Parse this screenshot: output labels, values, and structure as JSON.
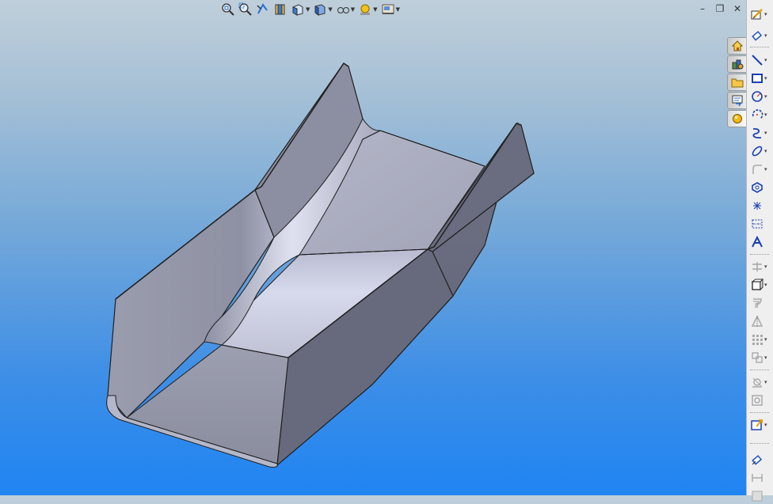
{
  "colors": {
    "background_top": "#bfcfda",
    "background_bottom": "#1f84f2",
    "part_face_light": "#c6c8dc",
    "part_face_mid": "#a3a6b6",
    "part_face_dark": "#6a6d80",
    "part_edge": "#202020"
  },
  "headsup_toolbar": {
    "items": [
      {
        "icon": "zoom-to-fit-icon"
      },
      {
        "icon": "zoom-to-area-icon"
      },
      {
        "icon": "previous-view-icon"
      },
      {
        "icon": "section-view-icon"
      },
      {
        "icon": "view-orientation-icon",
        "dropdown": true
      },
      {
        "icon": "display-style-icon",
        "dropdown": true
      },
      {
        "icon": "hide-show-items-icon",
        "dropdown": true
      },
      {
        "icon": "edit-appearance-icon",
        "dropdown": true
      },
      {
        "icon": "apply-scene-icon",
        "dropdown": true
      }
    ]
  },
  "window_controls": {
    "minimize": "–",
    "restore": "❐",
    "close": "✕"
  },
  "task_pane": {
    "tabs": [
      {
        "icon": "home-icon"
      },
      {
        "icon": "design-library-icon"
      },
      {
        "icon": "file-explorer-icon"
      },
      {
        "icon": "view-palette-icon"
      },
      {
        "icon": "appearances-icon"
      }
    ]
  },
  "command_toolbar": {
    "sketch_tools": [
      {
        "icon": "sketch-icon"
      },
      {
        "icon": "smart-dimension-icon",
        "dropdown": true
      },
      {
        "icon": "line-icon",
        "dropdown": true
      },
      {
        "icon": "rectangle-icon",
        "dropdown": true
      },
      {
        "icon": "circle-icon",
        "dropdown": true
      },
      {
        "icon": "arc-icon",
        "dropdown": true
      },
      {
        "icon": "spline-icon",
        "dropdown": true
      },
      {
        "icon": "ellipse-icon",
        "dropdown": true
      },
      {
        "icon": "fillet-icon",
        "dropdown": true
      },
      {
        "icon": "polygon-icon"
      },
      {
        "icon": "point-icon"
      },
      {
        "icon": "centerline-icon"
      },
      {
        "icon": "text-icon"
      }
    ],
    "feature_tools": [
      {
        "icon": "trim-entities-icon",
        "dropdown": true
      },
      {
        "icon": "convert-entities-icon",
        "dropdown": true
      },
      {
        "icon": "offset-entities-icon"
      },
      {
        "icon": "mirror-entities-icon"
      },
      {
        "icon": "linear-pattern-icon",
        "dropdown": true
      },
      {
        "icon": "move-entities-icon",
        "dropdown": true
      }
    ],
    "relation_tools": [
      {
        "icon": "display-relations-icon",
        "dropdown": true
      },
      {
        "icon": "repair-sketch-icon"
      }
    ],
    "other_tools": [
      {
        "icon": "quick-snaps-icon",
        "dropdown": true
      }
    ],
    "bottom_tools": [
      {
        "icon": "rapid-sketch-icon"
      },
      {
        "icon": "instant2d-icon"
      },
      {
        "icon": "shaded-sketch-icon"
      }
    ]
  }
}
